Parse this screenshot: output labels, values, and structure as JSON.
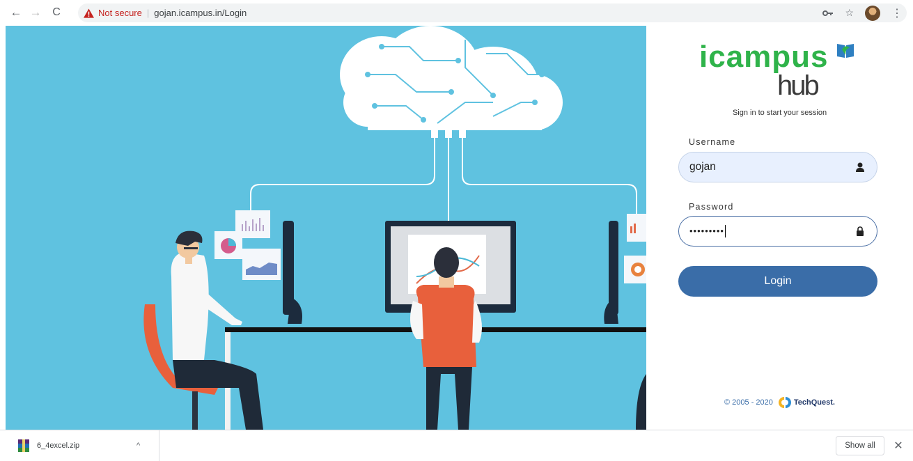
{
  "browser": {
    "back_icon": "←",
    "forward_icon": "→",
    "reload_icon": "C",
    "security_label": "Not secure",
    "separator": "|",
    "url": "gojan.icampus.in/Login",
    "key_icon": "key-icon",
    "star_icon": "☆",
    "menu_icon": "⋮"
  },
  "login": {
    "logo_text": "icampus",
    "logo_sub": "hub",
    "subtitle": "Sign in to start your session",
    "username_label": "Username",
    "username_value": "gojan",
    "password_label": "Password",
    "password_value": "•••••••••",
    "button_label": "Login",
    "footer_text": "© 2005 - 2020",
    "footer_brand": "TechQuest."
  },
  "downloads": {
    "filename": "6_4excel.zip",
    "chevron": "^",
    "show_all": "Show all",
    "close": "✕"
  },
  "colors": {
    "hero_bg": "#5fc2e0",
    "brand_green": "#2fb34a",
    "button_blue": "#3a6da8",
    "not_secure_red": "#c5221f"
  }
}
